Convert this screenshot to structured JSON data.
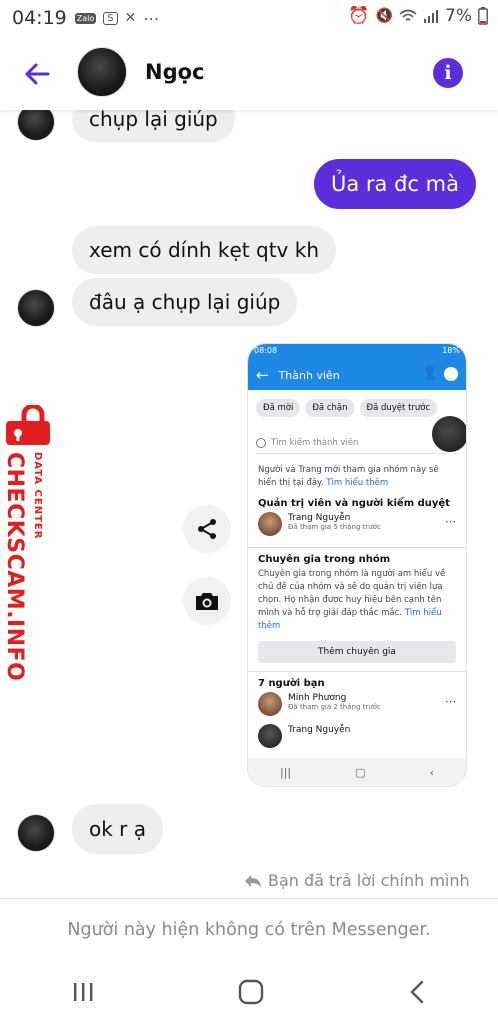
{
  "status_bar": {
    "time": "04:19",
    "notification_icons": [
      "Zalo",
      "S",
      "✕",
      "⋯"
    ],
    "battery": "7%"
  },
  "header": {
    "contact_name": "Ngọc",
    "info_icon": "i"
  },
  "messages": [
    {
      "from": "them",
      "text": "chụp lại giúp"
    },
    {
      "from": "me",
      "text": "Ủa ra đc mà"
    },
    {
      "from": "them",
      "text": "xem có dính kẹt qtv kh"
    },
    {
      "from": "them",
      "text": "đâu ạ chụp lại giúp"
    },
    {
      "from": "them",
      "text": "ok r ạ"
    }
  ],
  "screenshot": {
    "status_time": "08:08",
    "status_battery": "18%",
    "title": "Thành viên",
    "chips": [
      "Đã mời",
      "Đã chặn",
      "Đã duyệt trước"
    ],
    "search_placeholder": "Tìm kiếm thành viên",
    "intro_text": "Người và Trang mới tham gia nhóm này sẽ hiển thị tại đây.",
    "intro_link": "Tìm hiểu thêm",
    "admins_heading": "Quản trị viên và người kiểm duyệt",
    "admin_member": {
      "name": "Trang Nguyễn",
      "detail": "Đã tham gia 5 tháng trước"
    },
    "experts_heading": "Chuyên gia trong nhóm",
    "experts_text": "Chuyên gia trong nhóm là người am hiểu về chủ đề của nhóm và sẽ do quản trị viên lựa chọn. Họ nhận được huy hiệu bên cạnh tên mình và hỗ trợ giải đáp thắc mắc.",
    "experts_link": "Tìm hiểu thêm",
    "add_expert_button": "Thêm chuyên gia",
    "friends_heading": "7 người bạn",
    "friend_members": [
      {
        "name": "Minh Phương",
        "detail": "Đã tham gia 2 tháng trước"
      },
      {
        "name": "Trang Nguyễn",
        "detail": ""
      }
    ]
  },
  "watermark": {
    "main": "CHECKSCAM.INFO",
    "sub": "DATA CENTER"
  },
  "reply_note": "Bạn đã trả lời chính mình",
  "unavailable_notice": "Người này hiện không có trên Messenger.",
  "colors": {
    "accent": "#5b2ddb",
    "bubble_in": "#eeeeef",
    "facebook_blue": "#1e88e5",
    "watermark_red": "#e02020"
  }
}
